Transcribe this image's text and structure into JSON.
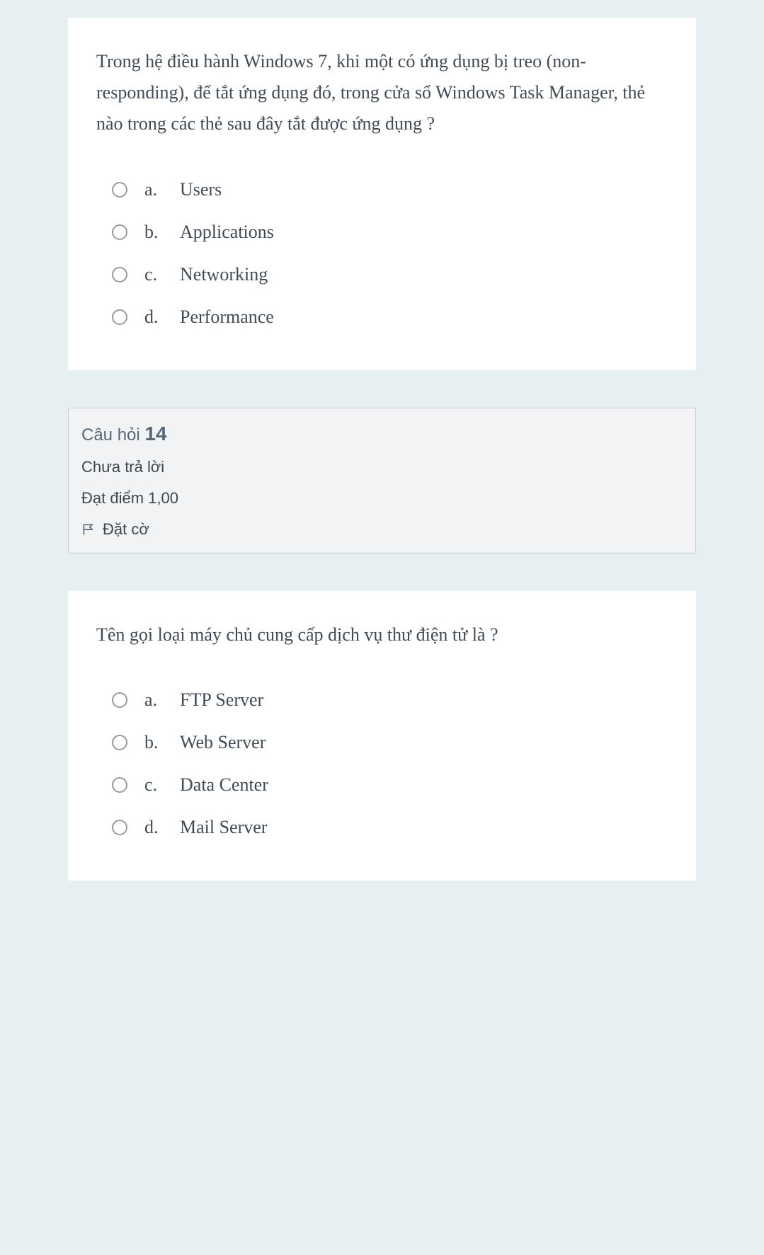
{
  "q1": {
    "text": "Trong hệ điều hành Windows 7, khi một có ứng dụng bị treo (non-responding), để tắt ứng dụng đó, trong cửa sổ Windows Task Manager, thẻ nào trong các thẻ sau đây tắt được ứng dụng ?",
    "options": {
      "a": {
        "letter": "a.",
        "text": "Users"
      },
      "b": {
        "letter": "b.",
        "text": "Applications"
      },
      "c": {
        "letter": "c.",
        "text": "Networking"
      },
      "d": {
        "letter": "d.",
        "text": "Performance"
      }
    }
  },
  "header": {
    "titlePrefix": "Câu hỏi ",
    "number": "14",
    "status": "Chưa trả lời",
    "score": "Đạt điểm 1,00",
    "flag": "Đặt cờ"
  },
  "q2": {
    "text": "Tên gọi loại máy chủ cung cấp dịch vụ thư điện tử là ?",
    "options": {
      "a": {
        "letter": "a.",
        "text": "FTP Server"
      },
      "b": {
        "letter": "b.",
        "text": "Web Server"
      },
      "c": {
        "letter": "c.",
        "text": "Data Center"
      },
      "d": {
        "letter": "d.",
        "text": "Mail Server"
      }
    }
  }
}
